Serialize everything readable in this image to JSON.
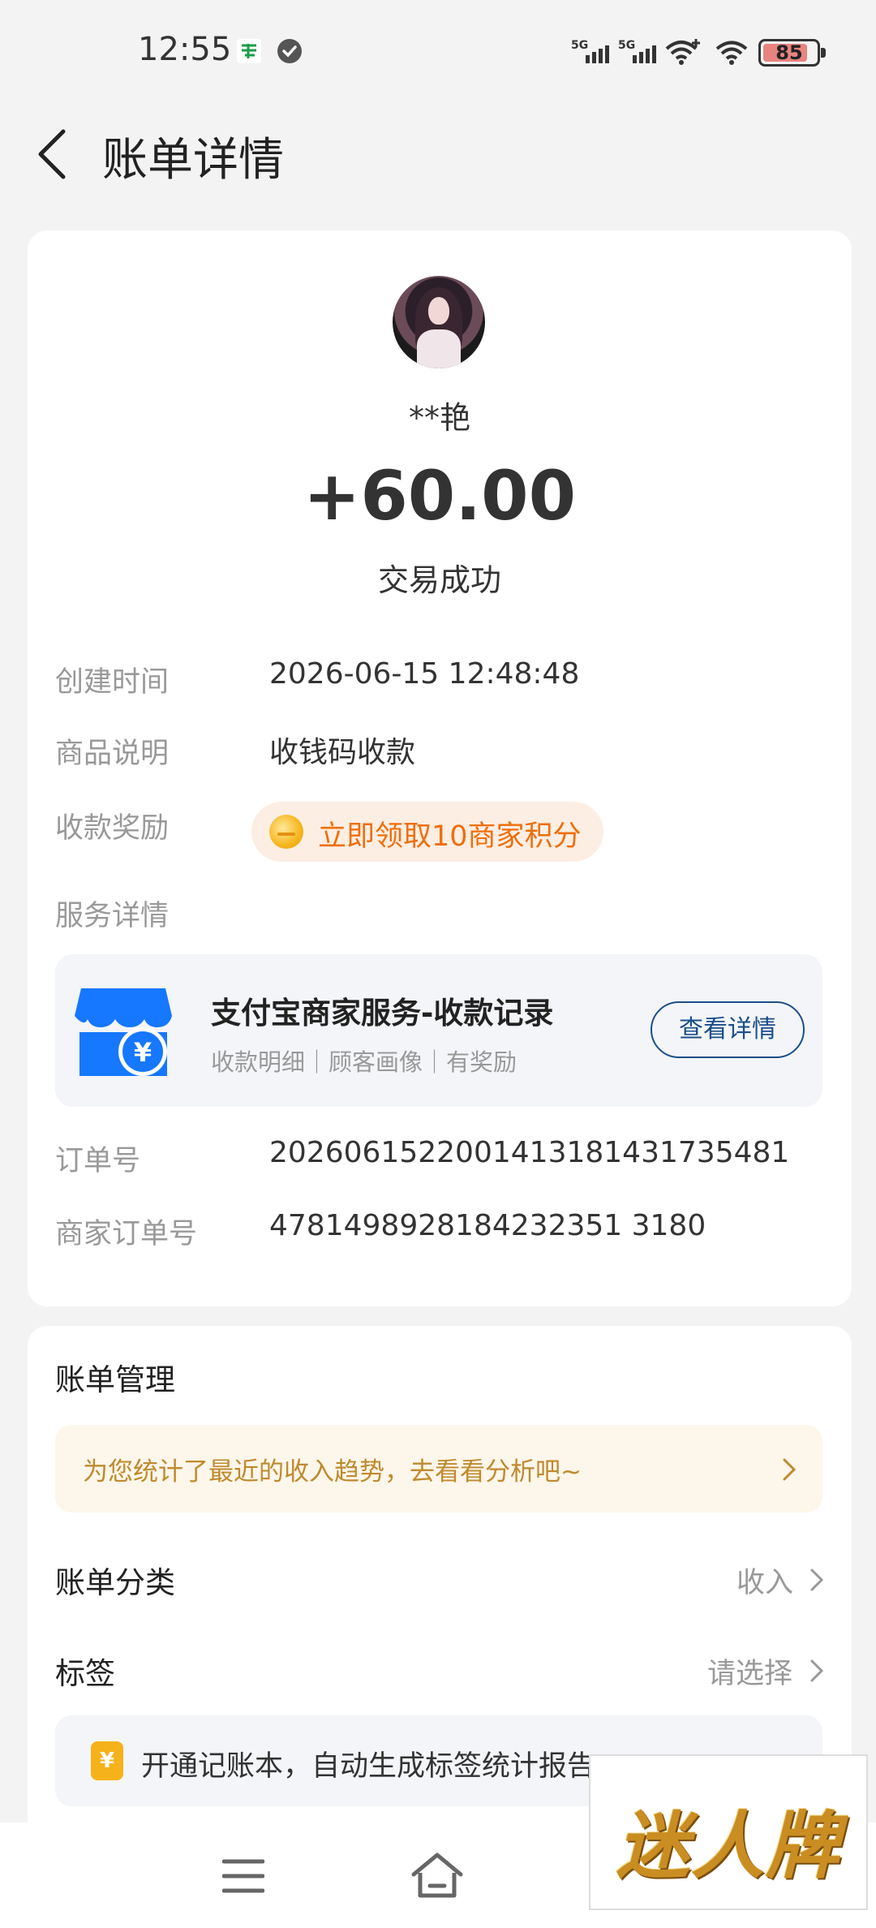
{
  "status_bar": {
    "time": "12:55",
    "signal_labels": [
      "5G",
      "5G"
    ],
    "battery": "85",
    "battery_level_percent": 85
  },
  "header": {
    "title": "账单详情"
  },
  "transaction": {
    "name": "**艳",
    "amount": "+60.00",
    "status": "交易成功"
  },
  "details": {
    "created_label": "创建时间",
    "created_value": "2026-06-15 12:48:48",
    "product_label": "商品说明",
    "product_value": "收钱码收款",
    "reward_label": "收款奖励",
    "reward_text": "立即领取10商家积分",
    "service_label": "服务详情",
    "order_label": "订单号",
    "order_value": "2026061522001413181431735481",
    "merchant_order_label": "商家订单号",
    "merchant_order_value": "4781498928184232351 3180"
  },
  "service": {
    "title": "支付宝商家服务-收款记录",
    "subtitle": "收款明细｜顾客画像｜有奖励",
    "button": "查看详情",
    "icon_symbol": "¥"
  },
  "manage": {
    "title": "账单管理",
    "trend_text": "为您统计了最近的收入趋势，去看看分析吧~",
    "category_label": "账单分类",
    "category_value": "收入",
    "tag_label": "标签",
    "tag_value": "请选择",
    "ledger_icon": "¥",
    "ledger_text": "开通记账本，自动生成标签统计报告"
  },
  "watermark": {
    "text": "迷人牌"
  },
  "colors": {
    "accent_orange": "#f06e0a",
    "store_blue": "#1677ff",
    "button_blue": "#1b4e8a",
    "trend_text": "#bf8a2e"
  }
}
